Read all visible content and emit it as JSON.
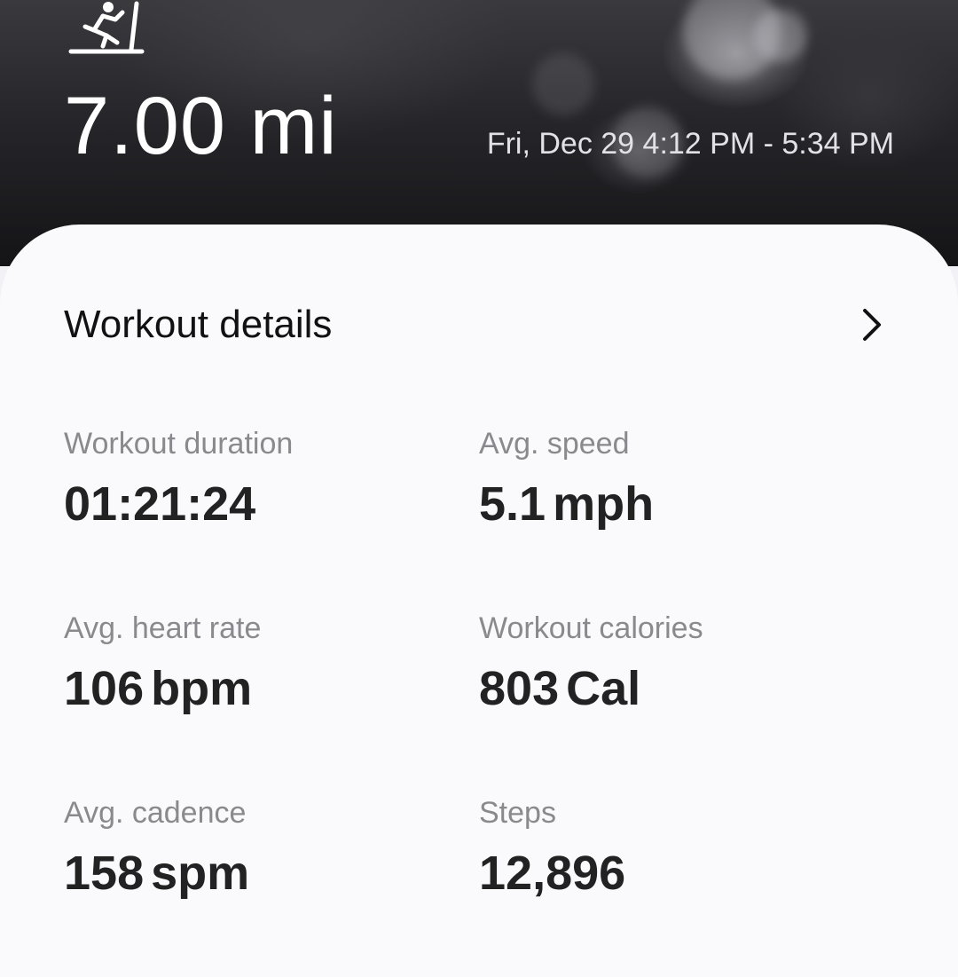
{
  "header": {
    "activity_icon": "treadmill-running-icon",
    "distance": "7.00 mi",
    "time_range": "Fri, Dec 29 4:12 PM - 5:34 PM"
  },
  "details": {
    "title": "Workout details",
    "chevron_icon": "chevron-right-icon",
    "stats": [
      {
        "label": "Workout duration",
        "value": "01:21:24",
        "unit": ""
      },
      {
        "label": "Avg. speed",
        "value": "5.1",
        "unit": "mph"
      },
      {
        "label": "Avg. heart rate",
        "value": "106",
        "unit": "bpm"
      },
      {
        "label": "Workout calories",
        "value": "803",
        "unit": "Cal"
      },
      {
        "label": "Avg. cadence",
        "value": "158",
        "unit": "spm"
      },
      {
        "label": "Steps",
        "value": "12,896",
        "unit": ""
      }
    ]
  },
  "colors": {
    "card_background": "#fafafd",
    "label_gray": "#8a8a8e",
    "value_dark": "#222222",
    "hero_text": "#ffffff"
  }
}
